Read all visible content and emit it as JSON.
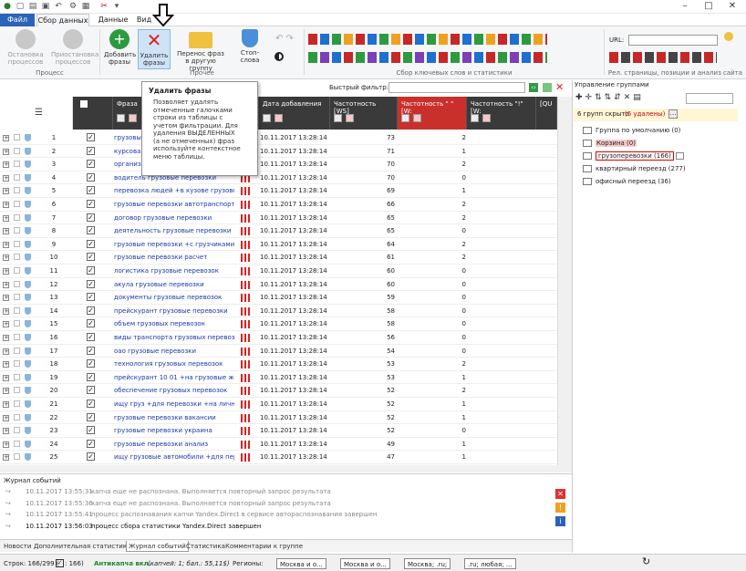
{
  "ribbon_tabs": {
    "file": "Файл",
    "collect": "Сбор данных",
    "data": "Данные",
    "view": "Вид"
  },
  "ribbon": {
    "stop": "Остановка процессов",
    "pause": "Приостановка процессов",
    "add": "Добавить фразы",
    "delete": "Удалить фразы",
    "move": "Перенос фраз в другую группу",
    "stopwords": "Стоп-слова",
    "group_process": "Процесс",
    "group_other": "Прочее",
    "group_collect": "Сбор ключевых слов и статистики",
    "group_rel": "Рел. страницы, позиции и анализ сайта",
    "url_label": "URL:"
  },
  "tooltip": {
    "title": "Удалить фразы",
    "body": "Позволяет удалять отмеченные галочками строки из таблицы с учетом фильтрации. Для удаления ВЫДЕЛЕННЫХ (а не отмеченных) фраз используйте контекстное меню таблицы."
  },
  "filter": {
    "label": "Быстрый фильтр:"
  },
  "columns": {
    "phrase": "Фраза",
    "date": "Дата добавления",
    "freq1": "Частотность [WS]",
    "freq2": "Частотность \" \" [W:",
    "freq3": "Частотность \"!\" [W:",
    "extra": "[QU"
  },
  "rows": [
    {
      "n": "1",
      "phrase": "грузовые перевозки",
      "date": "10.11.2017 13:28:14",
      "f1": "73",
      "f2": "2"
    },
    {
      "n": "2",
      "phrase": "курсовая грузовые перевозки",
      "date": "10.11.2017 13:28:14",
      "f1": "71",
      "f2": "1"
    },
    {
      "n": "3",
      "phrase": "организация грузовых перевозок",
      "date": "10.11.2017 13:28:14",
      "f1": "70",
      "f2": "2"
    },
    {
      "n": "4",
      "phrase": "водитель грузовые перевозки",
      "date": "10.11.2017 13:28:14",
      "f1": "70",
      "f2": "0"
    },
    {
      "n": "5",
      "phrase": "перевозка людей +в кузове грузово",
      "date": "10.11.2017 13:28:14",
      "f1": "69",
      "f2": "1"
    },
    {
      "n": "6",
      "phrase": "грузовые перевозки автотранспорт",
      "date": "10.11.2017 13:28:14",
      "f1": "66",
      "f2": "2"
    },
    {
      "n": "7",
      "phrase": "договор грузовые перевозки",
      "date": "10.11.2017 13:28:14",
      "f1": "65",
      "f2": "2"
    },
    {
      "n": "8",
      "phrase": "деятельность грузовые перевозки",
      "date": "10.11.2017 13:28:14",
      "f1": "65",
      "f2": "0"
    },
    {
      "n": "9",
      "phrase": "грузовые перевозки +с грузчиками",
      "date": "10.11.2017 13:28:14",
      "f1": "64",
      "f2": "2"
    },
    {
      "n": "10",
      "phrase": "грузовые перевозки расчет",
      "date": "10.11.2017 13:28:14",
      "f1": "61",
      "f2": "2"
    },
    {
      "n": "11",
      "phrase": "логистика грузовые перевозок",
      "date": "10.11.2017 13:28:14",
      "f1": "60",
      "f2": "0"
    },
    {
      "n": "12",
      "phrase": "акула грузовые перевозки",
      "date": "10.11.2017 13:28:14",
      "f1": "60",
      "f2": "0"
    },
    {
      "n": "13",
      "phrase": "документы грузовые перевозок",
      "date": "10.11.2017 13:28:14",
      "f1": "59",
      "f2": "0"
    },
    {
      "n": "14",
      "phrase": "прейскурант грузовые перевозки",
      "date": "10.11.2017 13:28:14",
      "f1": "58",
      "f2": "0"
    },
    {
      "n": "15",
      "phrase": "объем грузовых перевозок",
      "date": "10.11.2017 13:28:14",
      "f1": "58",
      "f2": "0"
    },
    {
      "n": "16",
      "phrase": "виды транспорта грузовых перевоз",
      "date": "10.11.2017 13:28:14",
      "f1": "56",
      "f2": "0"
    },
    {
      "n": "17",
      "phrase": "оао грузовые перевозки",
      "date": "10.11.2017 13:28:14",
      "f1": "54",
      "f2": "0"
    },
    {
      "n": "18",
      "phrase": "технология грузовых перевозок",
      "date": "10.11.2017 13:28:14",
      "f1": "53",
      "f2": "2"
    },
    {
      "n": "19",
      "phrase": "прейскурант 10 01 +на грузовые же.",
      "date": "10.11.2017 13:28:14",
      "f1": "53",
      "f2": "1"
    },
    {
      "n": "20",
      "phrase": "обеспечение грузовых перевозок",
      "date": "10.11.2017 13:28:14",
      "f1": "52",
      "f2": "2"
    },
    {
      "n": "21",
      "phrase": "ищу груз +для перевозки +на личнс",
      "date": "10.11.2017 13:28:14",
      "f1": "52",
      "f2": "1"
    },
    {
      "n": "22",
      "phrase": "грузовые перевозки вакансии",
      "date": "10.11.2017 13:28:14",
      "f1": "52",
      "f2": "1"
    },
    {
      "n": "23",
      "phrase": "грузовые перевозки украина",
      "date": "10.11.2017 13:28:14",
      "f1": "52",
      "f2": "0"
    },
    {
      "n": "24",
      "phrase": "грузовые перевозки анализ",
      "date": "10.11.2017 13:28:14",
      "f1": "49",
      "f2": "1"
    },
    {
      "n": "25",
      "phrase": "ищу грузовые автомобили +для пер",
      "date": "10.11.2017 13:28:14",
      "f1": "47",
      "f2": "1"
    }
  ],
  "log": {
    "title": "Журнал событий",
    "entries": [
      {
        "time": "10.11.2017 13:55:31",
        "text": "капча еще не распознана. Выполняется повторный запрос результата"
      },
      {
        "time": "10.11.2017 13:55:36",
        "text": "капча еще не распознана. Выполняется повторный запрос результата"
      },
      {
        "time": "10.11.2017 13:55:41",
        "text": "процесс распознавания капчи Yandex.Direct в сервисе автораспознавания завершен"
      },
      {
        "time": "10.11.2017 13:56:03",
        "text": "процесс сбора статистики Yandex.Direct завершен"
      }
    ]
  },
  "bottom_tabs": [
    "Новости",
    "Дополнительная статистика",
    "Журнал событий",
    "Статистика",
    "Комментарии к группе"
  ],
  "status": {
    "rows": "Строк: 166/299 (",
    "checked": ": 166)",
    "anticaptcha": "Антикапча вкл.",
    "captcha_info": "(капчей: 1; бал.: 55,11$)",
    "regions_label": "Регионы:",
    "regions": [
      "Москва и о...",
      "Москва и о...",
      "Москва; .ru;",
      ".ru; любая; ..."
    ]
  },
  "groups": {
    "title": "Управление группами",
    "hidden_prefix": "6 групп скрыто",
    "hidden_deleted": "(6 удалены)",
    "items": [
      {
        "label": "Группа по умолчанию (0)"
      },
      {
        "label": "Корзина (0)"
      },
      {
        "label": "грузоперевозки (166)"
      },
      {
        "label": "квартирный переезд (277)"
      },
      {
        "label": "офисный переезд (36)"
      }
    ]
  },
  "colors": {
    "accent": "#2b63b8",
    "red": "#c9302c",
    "header": "#3a3a3a"
  }
}
